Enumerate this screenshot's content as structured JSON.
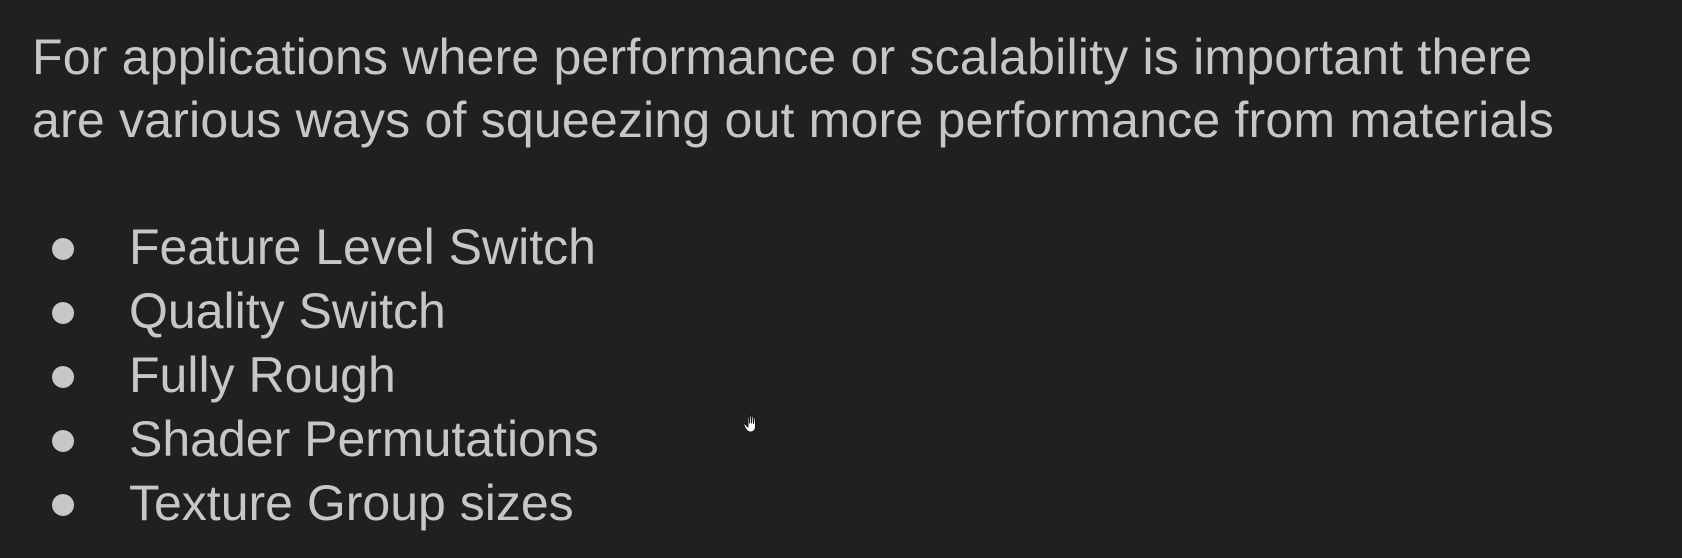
{
  "intro": {
    "line1": "For applications where performance or scalability is important there",
    "line2": "are various ways of squeezing out more performance from materials"
  },
  "bullets": [
    {
      "label": "Feature Level Switch"
    },
    {
      "label": "Quality Switch"
    },
    {
      "label": "Fully Rough"
    },
    {
      "label": "Shader Permutations"
    },
    {
      "label": "Texture Group sizes"
    }
  ],
  "cursor": {
    "icon": "hand-cursor-icon"
  },
  "colors": {
    "background": "#202020",
    "text": "#c7c7c7"
  }
}
